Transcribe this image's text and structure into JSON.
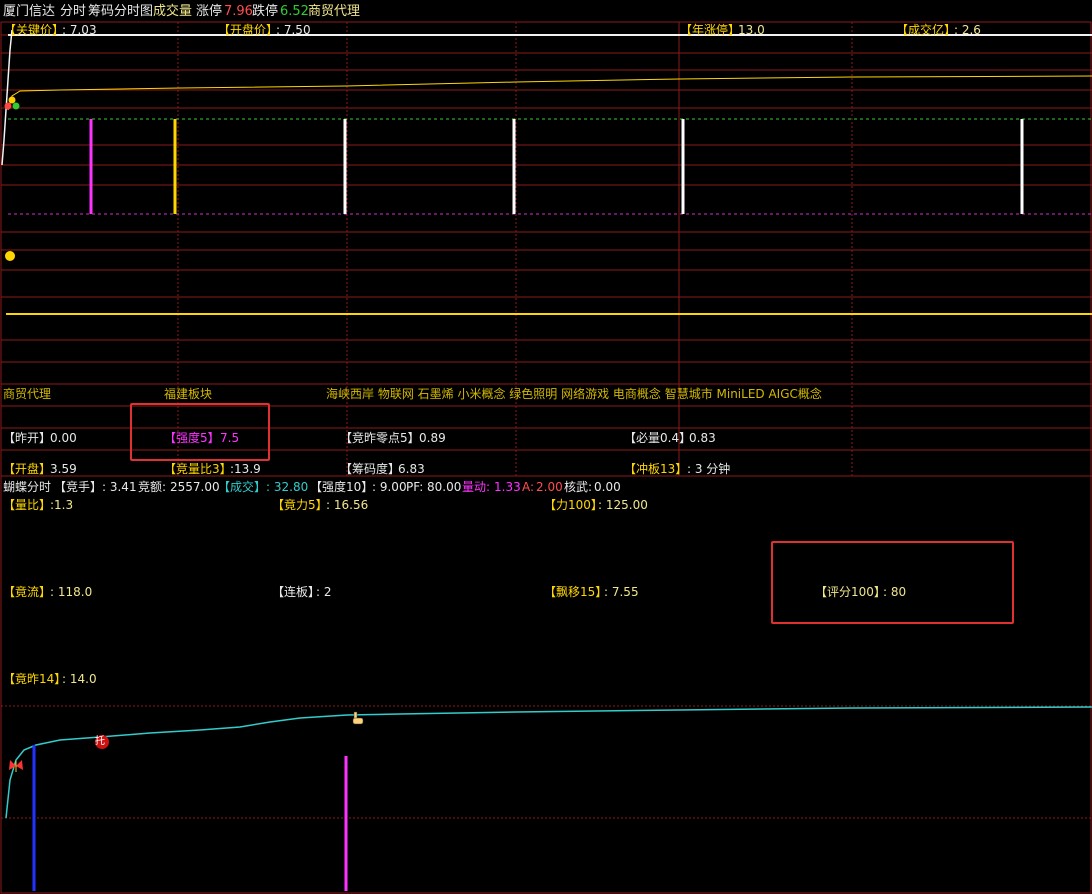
{
  "header": {
    "stock_name": "厦门信达",
    "tab_fenshi": "分时",
    "tab_chouma": "筹码分时图",
    "volume_label": "成交量",
    "zhangting_label": "涨停",
    "zhangting_value": "7.96",
    "dieting_label": "跌停",
    "dieting_value": "6.52",
    "sector": "商贸代理"
  },
  "chart_top": {
    "guanjian_label": "【关键价】",
    "guanjian_value": ": 7.03",
    "kaipan_label": "【开盘价】",
    "kaipan_value": ": 7.50",
    "nianzhangting_label": "【年涨停】",
    "nianzhangting_value": "13.0",
    "chengjiaoyi_label": "【成交亿】",
    "chengjiaoyi_value": ": 2.6"
  },
  "info_panel": {
    "sector_main": "商贸代理",
    "region": "福建板块",
    "concepts": "海峡西岸 物联网 石墨烯 小米概念 绿色照明 网络游戏 电商概念 智慧城市 MiniLED AIGC概念",
    "zuokai_label": "【昨开】",
    "zuokai_value": "0.00",
    "qiangdu5_label": "【强度5】",
    "qiangdu5_value": "7.5",
    "jingzuolingdian_label": "【竞昨零点5】",
    "jingzuolingdian_value": "0.89",
    "biliang_label": "【必量0.4】",
    "biliang_value": "0.83",
    "kaipan_label": "【开盘】",
    "kaipan_value": "3.59",
    "jingliangbi_label": "【竞量比3】",
    "jingliangbi_value": ":13.9",
    "choumadu_label": "【筹码度】",
    "choumadu_value": "6.83",
    "chongban_label": "【冲板13】",
    "chongban_value": ": 3 分钟"
  },
  "butterfly_bar": {
    "title": "蝴蝶分时",
    "jingshou_label": "【竞手】",
    "jingshou_value": ": 3.41",
    "jinge_label": "竞额:",
    "jinge_value": "2557.00",
    "chengjiao_label": "【成交】",
    "chengjiao_value": ": 32.80",
    "qiangdu10_label": "【强度10】",
    "qiangdu10_value": ": 9.00",
    "pf_label": "PF:",
    "pf_value": "80.00",
    "liangdong_label": "量动:",
    "liangdong_value": "1.33",
    "a_label": "A:",
    "a_value": "2.00",
    "hewu_label": "核武:",
    "hewu_value": "0.00"
  },
  "indicators": {
    "liangbi_label": "【量比】",
    "liangbi_value": ":1.3",
    "jingli5_label": "【竟力5】",
    "jingli5_value": ":  16.56",
    "li100_label": "【力100】",
    "li100_value": ":  125.00",
    "jingliu_label": "【竟流】",
    "jingliu_value": ": 118.0",
    "lianban_label": "【连板】",
    "lianban_value": ":  2",
    "piaoyi_label": "【飘移15】",
    "piaoyi_value": ":  7.55",
    "pingfen_label": "【评分100】",
    "pingfen_value": ":  80",
    "jingzuo14_label": "【竟昨14】",
    "jingzuo14_value": ": 14.0"
  },
  "markers": {
    "tuo": "托"
  },
  "colors": {
    "grid_red": "#8b1a1a",
    "price_yellow": "#ffd700",
    "line_cyan": "#33cccc",
    "highlight_red": "#e03030"
  }
}
